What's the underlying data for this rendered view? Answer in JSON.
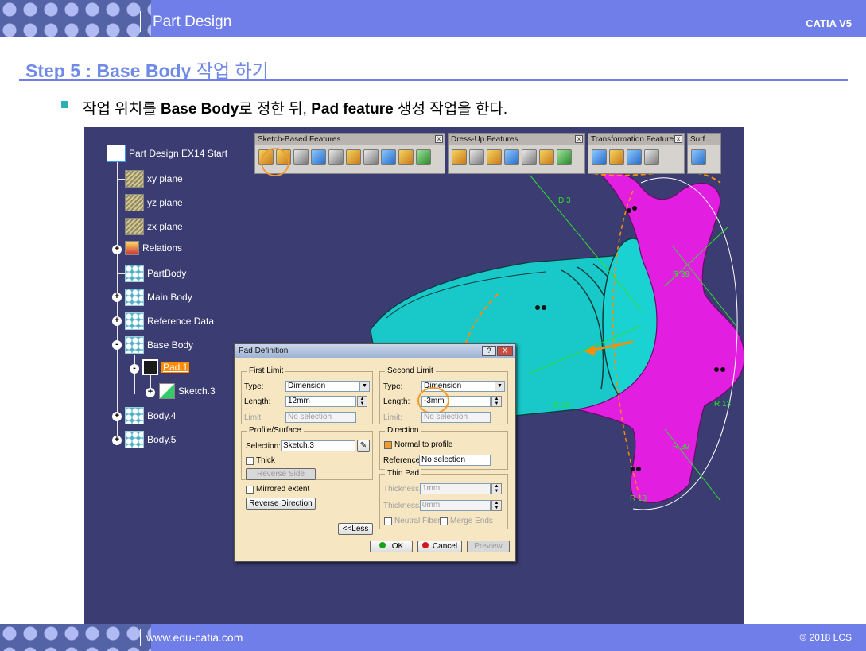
{
  "header": {
    "title": "Part Design",
    "brand": "CATIA V5"
  },
  "step": {
    "prefix": "Step 5 : Base Body ",
    "korean": "작업 하기"
  },
  "bullet": {
    "t1": "작업 위치를 ",
    "b1": "Base Body",
    "t2": "로 정한 뒤, ",
    "b2": "Pad feature",
    "t3": " 생성 작업을 한다."
  },
  "tree": {
    "root": "Part Design EX14 Start",
    "items": [
      "xy plane",
      "yz plane",
      "zx plane",
      "Relations",
      "PartBody",
      "Main Body",
      "Reference Data",
      "Base Body",
      "Pad.1",
      "Sketch.3",
      "Body.4",
      "Body.5"
    ]
  },
  "toolbars": [
    {
      "title": "Sketch-Based Features"
    },
    {
      "title": "Dress-Up Features"
    },
    {
      "title": "Transformation Features"
    },
    {
      "title": "Surf..."
    }
  ],
  "annotations": [
    "R 39",
    "R 39",
    "R 39",
    "R 13",
    "R 13",
    "D 3"
  ],
  "dialog": {
    "title": "Pad Definition",
    "help": "?",
    "close": "X",
    "first_limit": {
      "label": "First Limit",
      "type_label": "Type:",
      "type_value": "Dimension",
      "length_label": "Length:",
      "length_value": "12mm",
      "limit_label": "Limit:",
      "limit_value": "No selection"
    },
    "second_limit": {
      "label": "Second Limit",
      "type_label": "Type:",
      "type_value": "Dimension",
      "length_label": "Length:",
      "length_value": "-3mm",
      "limit_label": "Limit:",
      "limit_value": "No selection"
    },
    "profile": {
      "label": "Profile/Surface",
      "selection_label": "Selection:",
      "selection_value": "Sketch.3",
      "thick_label": "Thick",
      "reverse_side": "Reverse Side"
    },
    "direction": {
      "label": "Direction",
      "normal_label": "Normal to profile",
      "reference_label": "Reference:",
      "reference_value": "No selection"
    },
    "thin_pad": {
      "label": "Thin Pad",
      "thickness1_label": "Thickness1:",
      "thickness1_value": "1mm",
      "thickness2_label": "Thickness2:",
      "thickness2_value": "0mm",
      "neutral_label": "Neutral Fiber",
      "merge_label": "Merge Ends"
    },
    "mirrored_label": "Mirrored extent",
    "reverse_direction": "Reverse Direction",
    "less": "<<Less",
    "ok": "OK",
    "cancel": "Cancel",
    "preview": "Preview"
  },
  "footer": {
    "url": "www.edu-catia.com",
    "copyright": "© 2018 LCS"
  },
  "colors": {
    "accent": "#6f7ee8",
    "viewport": "#3a3c72",
    "magenta": "#e21fe0",
    "cyan": "#19c8c8",
    "highlight": "#f19a30"
  }
}
